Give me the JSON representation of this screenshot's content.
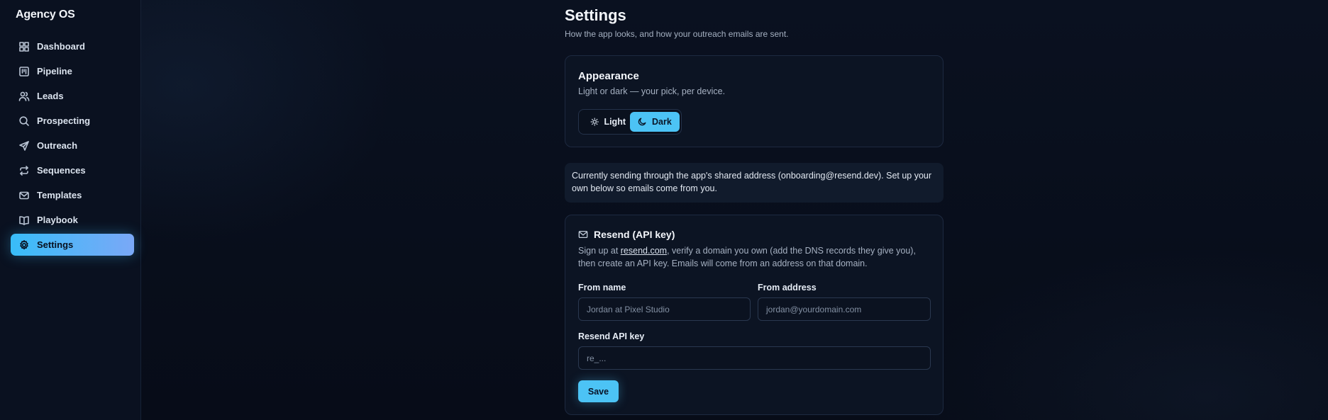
{
  "app": {
    "name": "Agency OS"
  },
  "sidebar": {
    "items": [
      {
        "label": "Dashboard",
        "icon": "dashboard-icon"
      },
      {
        "label": "Pipeline",
        "icon": "pipeline-icon"
      },
      {
        "label": "Leads",
        "icon": "users-icon"
      },
      {
        "label": "Prospecting",
        "icon": "search-icon"
      },
      {
        "label": "Outreach",
        "icon": "send-icon"
      },
      {
        "label": "Sequences",
        "icon": "repeat-icon"
      },
      {
        "label": "Templates",
        "icon": "mail-icon"
      },
      {
        "label": "Playbook",
        "icon": "book-icon"
      },
      {
        "label": "Settings",
        "icon": "gear-icon",
        "active": true
      }
    ]
  },
  "page": {
    "title": "Settings",
    "subtitle": "How the app looks, and how your outreach emails are sent."
  },
  "appearance": {
    "title": "Appearance",
    "description": "Light or dark — your pick, per device.",
    "options": {
      "light": "Light",
      "dark": "Dark"
    },
    "selected": "Dark"
  },
  "notice": {
    "text": "Currently sending through the app's shared address (onboarding@resend.dev). Set up your own below so emails come from you."
  },
  "resend": {
    "title": "Resend (API key)",
    "desc_before": "Sign up at ",
    "link": "resend.com",
    "desc_after": ", verify a domain you own (add the DNS records they give you), then create an API key. Emails will come from an address on that domain.",
    "from_name": {
      "label": "From name",
      "placeholder": "Jordan at Pixel Studio"
    },
    "from_address": {
      "label": "From address",
      "placeholder": "jordan@yourdomain.com"
    },
    "api_key": {
      "label": "Resend API key",
      "placeholder": "re_..."
    },
    "save_label": "Save"
  },
  "colors": {
    "accent": "#4cc3f5",
    "background": "#070c18",
    "card": "#0c1423"
  }
}
